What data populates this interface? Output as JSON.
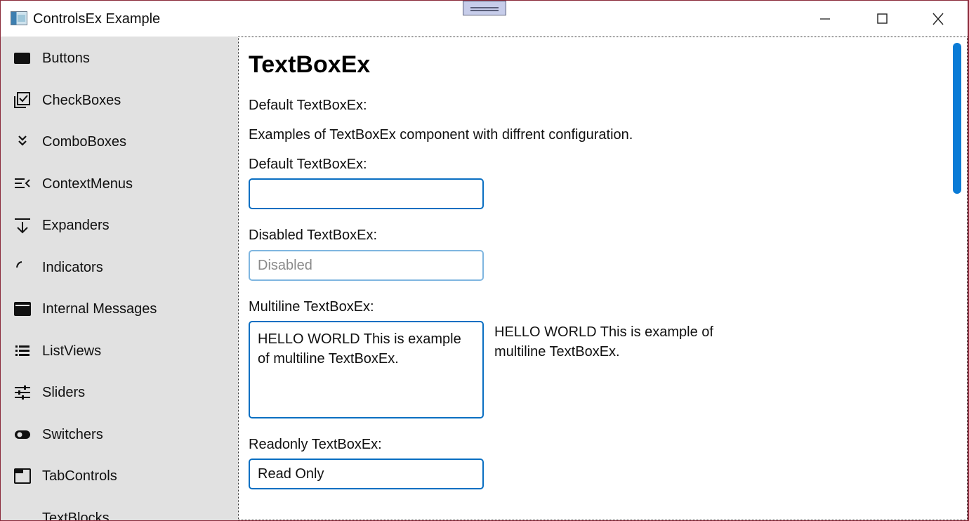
{
  "window": {
    "title": "ControlsEx Example"
  },
  "sidebar": {
    "items": [
      {
        "label": "Buttons",
        "icon": "button-icon"
      },
      {
        "label": "CheckBoxes",
        "icon": "checkboxes-icon"
      },
      {
        "label": "ComboBoxes",
        "icon": "chevron-double-down-icon"
      },
      {
        "label": "ContextMenus",
        "icon": "context-menu-icon"
      },
      {
        "label": "Expanders",
        "icon": "expander-icon"
      },
      {
        "label": "Indicators",
        "icon": "progress-arc-icon"
      },
      {
        "label": "Internal Messages",
        "icon": "message-icon"
      },
      {
        "label": "ListViews",
        "icon": "list-icon"
      },
      {
        "label": "Sliders",
        "icon": "sliders-icon"
      },
      {
        "label": "Switchers",
        "icon": "toggle-icon"
      },
      {
        "label": "TabControls",
        "icon": "tab-icon"
      },
      {
        "label": "TextBlocks",
        "icon": "text-lines-icon"
      }
    ]
  },
  "main": {
    "heading": "TextBoxEx",
    "subtitle": "Default TextBoxEx:",
    "description": "Examples of TextBoxEx component with diffrent configuration.",
    "default_label": "Default TextBoxEx:",
    "default_value": "",
    "disabled_label": "Disabled TextBoxEx:",
    "disabled_value": "Disabled",
    "multiline_label": "Multiline TextBoxEx:",
    "multiline_value": "HELLO WORLD This is example of multiline TextBoxEx.",
    "multiline_mirror": "HELLO WORLD This is example of multiline TextBoxEx.",
    "readonly_label": "Readonly TextBoxEx:",
    "readonly_value": "Read Only"
  },
  "colors": {
    "accent": "#0a6fc2",
    "sidebar": "#e1e1e1",
    "scrollbar": "#0a7bd6"
  }
}
